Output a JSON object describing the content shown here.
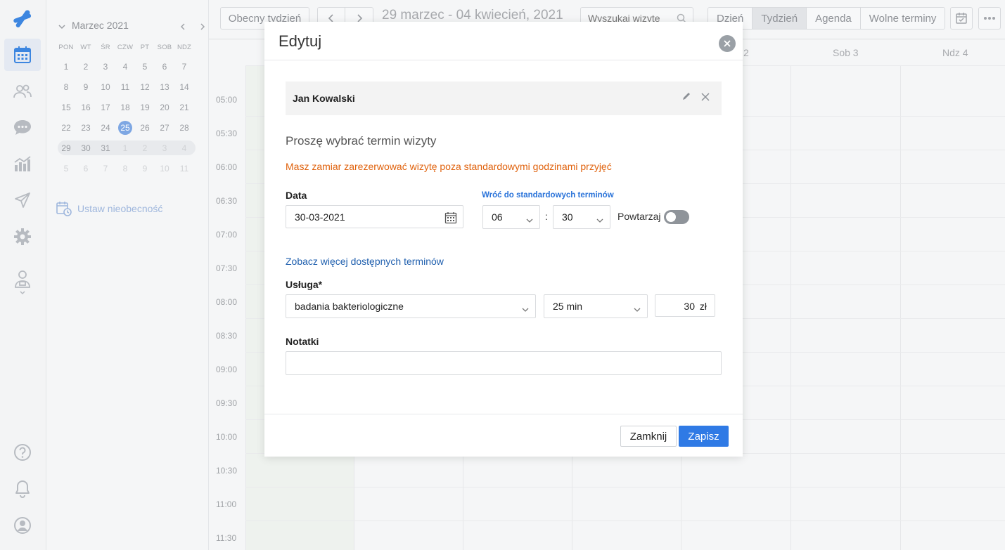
{
  "rail": {
    "items": [
      {
        "name": "logo-icon"
      },
      {
        "name": "calendar-icon",
        "active": true
      },
      {
        "name": "users-icon"
      },
      {
        "name": "chat-icon"
      },
      {
        "name": "stats-icon"
      },
      {
        "name": "send-icon"
      },
      {
        "name": "settings-icon"
      },
      {
        "name": "profile-icon"
      },
      {
        "name": "help-icon"
      },
      {
        "name": "bell-icon"
      },
      {
        "name": "account-icon"
      }
    ]
  },
  "minical": {
    "title": "Marzec 2021",
    "dow": [
      "PON",
      "WT",
      "ŚR",
      "CZW",
      "PT",
      "SOB",
      "NDZ"
    ],
    "weeks": [
      [
        "1",
        "2",
        "3",
        "4",
        "5",
        "6",
        "7"
      ],
      [
        "8",
        "9",
        "10",
        "11",
        "12",
        "13",
        "14"
      ],
      [
        "15",
        "16",
        "17",
        "18",
        "19",
        "20",
        "21"
      ],
      [
        "22",
        "23",
        "24",
        "25",
        "26",
        "27",
        "28"
      ],
      [
        "29",
        "30",
        "31",
        "1",
        "2",
        "3",
        "4"
      ],
      [
        "5",
        "6",
        "7",
        "8",
        "9",
        "10",
        "11"
      ]
    ],
    "today": "25",
    "absence_label": "Ustaw nieobecność"
  },
  "toolbar": {
    "current_week": "Obecny tydzień",
    "range": "29 marzec - 04 kwiecień, 2021",
    "search_placeholder": "Wyszukaj wizytę",
    "views": [
      "Dzień",
      "Tydzień",
      "Agenda",
      "Wolne terminy"
    ],
    "active_view": "Tydzień"
  },
  "calendar": {
    "day_headers": [
      "Sob 3",
      "Ndz 4"
    ],
    "partial_day_header": "2",
    "times": [
      "05:00",
      "05:30",
      "06:00",
      "06:30",
      "07:00",
      "07:30",
      "08:00",
      "08:30",
      "09:00",
      "09:30",
      "10:00",
      "10:30",
      "11:00",
      "11:30"
    ]
  },
  "modal": {
    "title": "Edytuj",
    "patient_name": "Jan Kowalski",
    "choose_heading": "Proszę wybrać termin wizyty",
    "warning": "Masz zamiar zarezerwować wizytę poza standardowymi godzinami przyjęć",
    "date_label": "Data",
    "date_value": "30-03-2021",
    "back_to_standard": "Wróć do standardowych terminów",
    "hour_value": "06",
    "minute_value": "30",
    "time_separator": ":",
    "repeat_label": "Powtarzaj",
    "repeat_on": false,
    "more_slots_link": "Zobacz więcej dostępnych terminów",
    "service_label": "Usługa*",
    "service_value": "badania bakteriologiczne",
    "duration_value": "25 min",
    "price_value": "30",
    "currency": "zł",
    "notes_label": "Notatki",
    "notes_value": "",
    "close_button": "Zamknij",
    "save_button": "Zapisz"
  },
  "colors": {
    "accent": "#2f7ae5",
    "warning": "#e0620d",
    "link": "#1f5fae",
    "today_badge": "#7ea7e3"
  }
}
